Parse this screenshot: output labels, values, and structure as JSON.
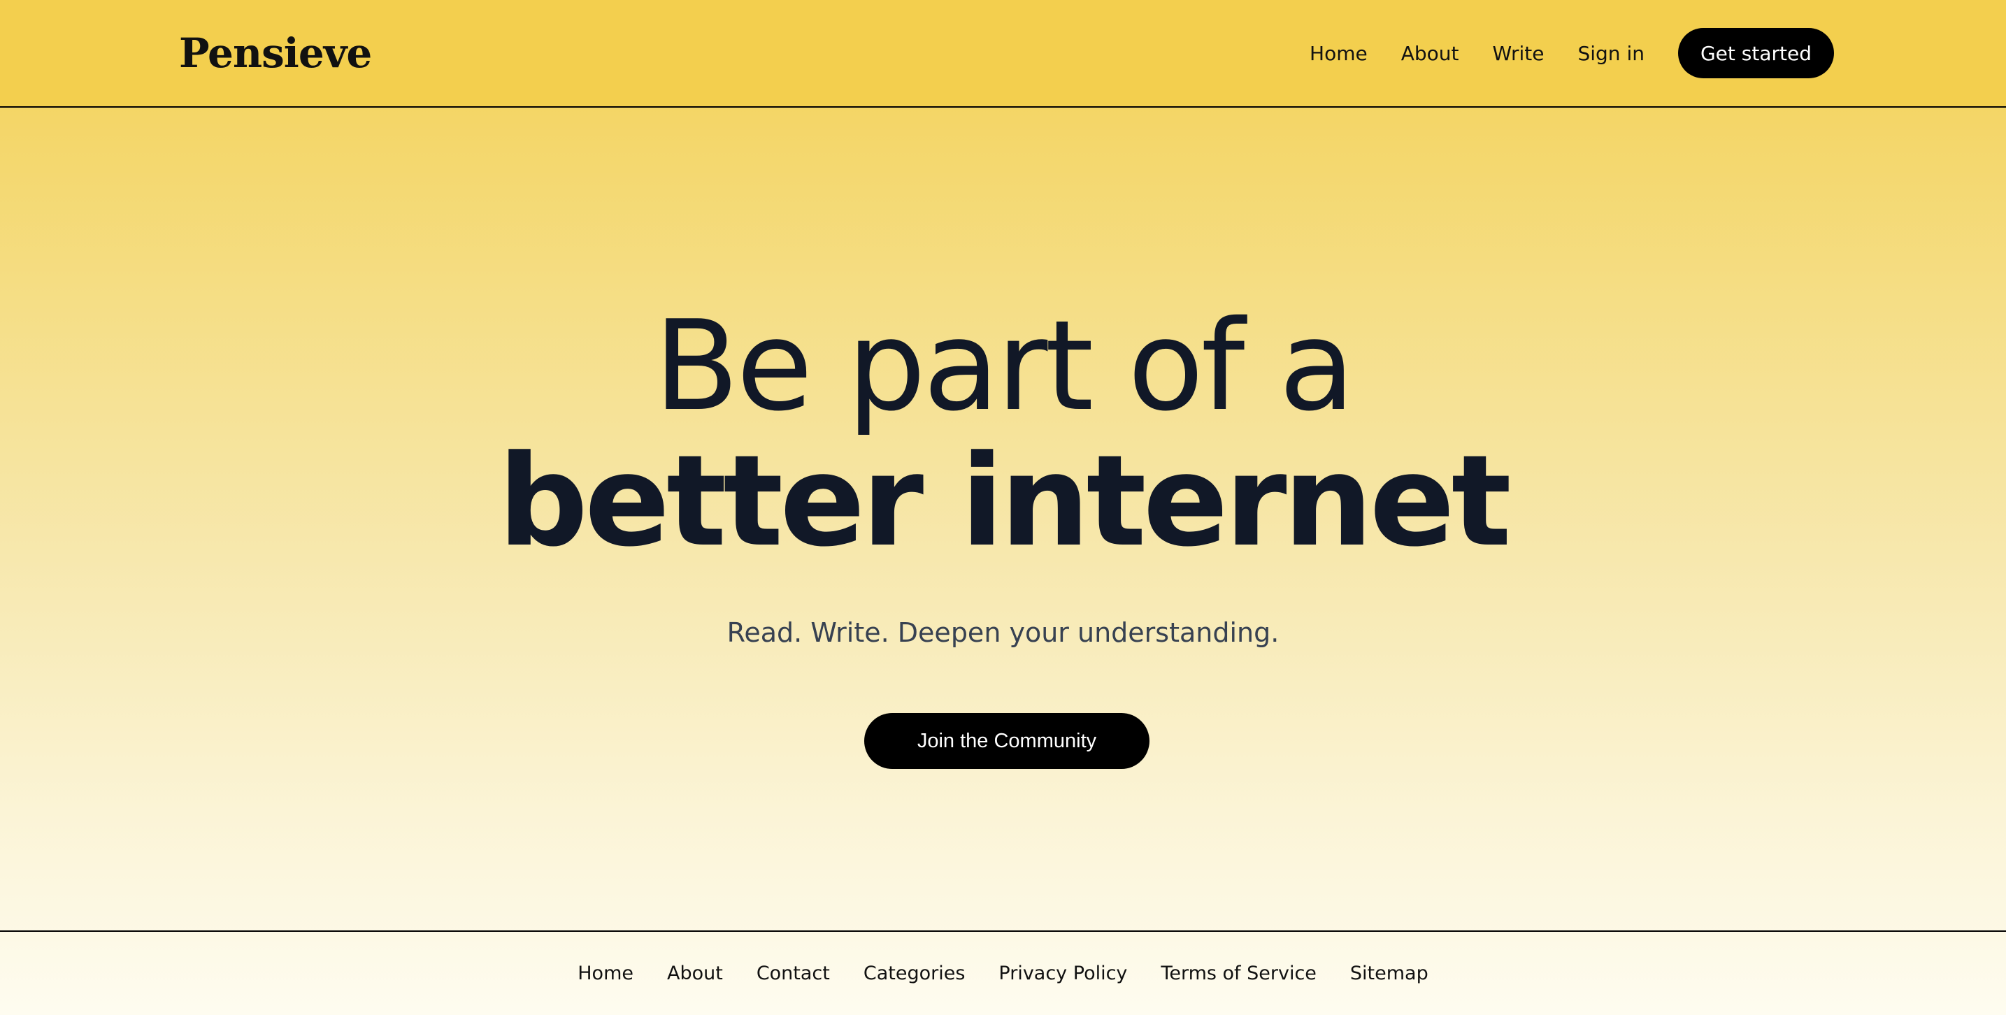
{
  "header": {
    "logo": "Pensieve",
    "nav": [
      {
        "label": "Home"
      },
      {
        "label": "About"
      },
      {
        "label": "Write"
      },
      {
        "label": "Sign in"
      }
    ],
    "cta_label": "Get started"
  },
  "hero": {
    "headline_line1": "Be part of a",
    "headline_line2": "better internet",
    "subheadline": "Read. Write. Deepen your understanding.",
    "cta_label": "Join the Community"
  },
  "footer": {
    "links": [
      {
        "label": "Home"
      },
      {
        "label": "About"
      },
      {
        "label": "Contact"
      },
      {
        "label": "Categories"
      },
      {
        "label": "Privacy Policy"
      },
      {
        "label": "Terms of Service"
      },
      {
        "label": "Sitemap"
      }
    ]
  },
  "colors": {
    "header_bg": "#F3CF4E",
    "button_bg": "#000000",
    "button_text": "#FFFFFF",
    "headline_text": "#111827",
    "subheadline_text": "#374151"
  }
}
